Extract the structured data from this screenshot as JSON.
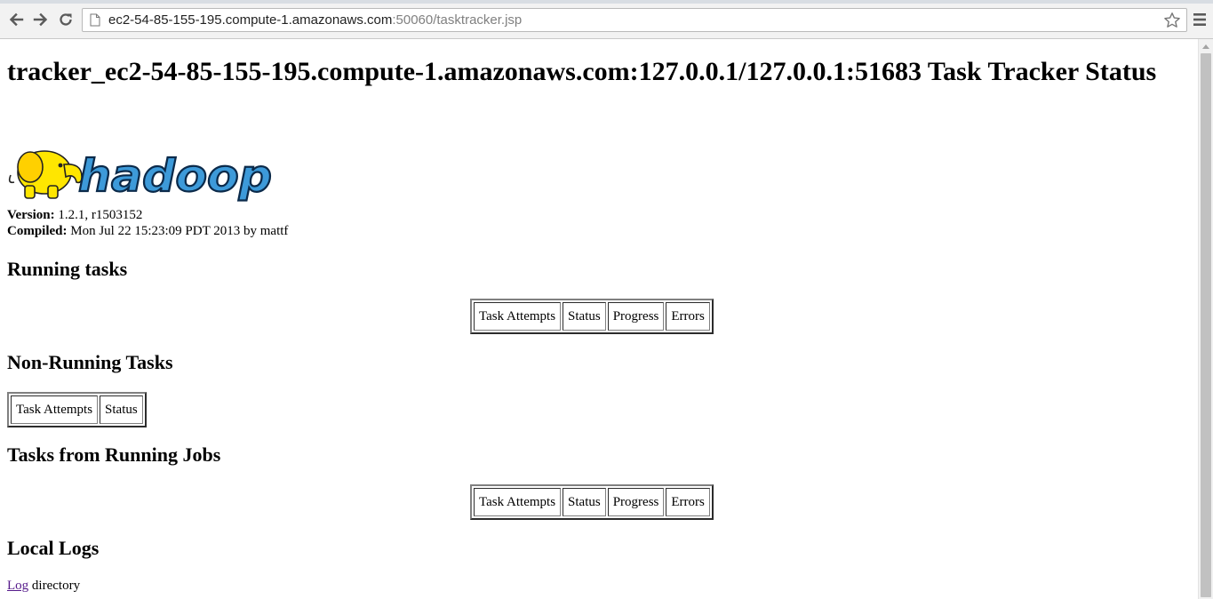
{
  "browser": {
    "url_host": "ec2-54-85-155-195.compute-1.amazonaws.com",
    "url_rest": ":50060/tasktracker.jsp"
  },
  "page": {
    "title": "tracker_ec2-54-85-155-195.compute-1.amazonaws.com:127.0.0.1/127.0.0.1:51683 Task Tracker Status",
    "logo_alt": "hadoop",
    "version_label": "Version:",
    "version_value": "1.2.1, r1503152",
    "compiled_label": "Compiled:",
    "compiled_value": "Mon Jul 22 15:23:09 PDT 2013 by mattf"
  },
  "sections": {
    "running": {
      "heading": "Running tasks",
      "columns": [
        "Task Attempts",
        "Status",
        "Progress",
        "Errors"
      ]
    },
    "non_running": {
      "heading": "Non-Running Tasks",
      "columns": [
        "Task Attempts",
        "Status"
      ]
    },
    "from_running_jobs": {
      "heading": "Tasks from Running Jobs",
      "columns": [
        "Task Attempts",
        "Status",
        "Progress",
        "Errors"
      ]
    },
    "local_logs": {
      "heading": "Local Logs",
      "link_text": "Log",
      "suffix_text": "directory"
    }
  },
  "colors": {
    "link_visited": "#551a8b",
    "logo_text": "#3d9ad9",
    "elephant": "#ffe600"
  },
  "icons": [
    "back-arrow-icon",
    "forward-arrow-icon",
    "reload-icon",
    "page-icon",
    "star-icon",
    "menu-icon"
  ]
}
